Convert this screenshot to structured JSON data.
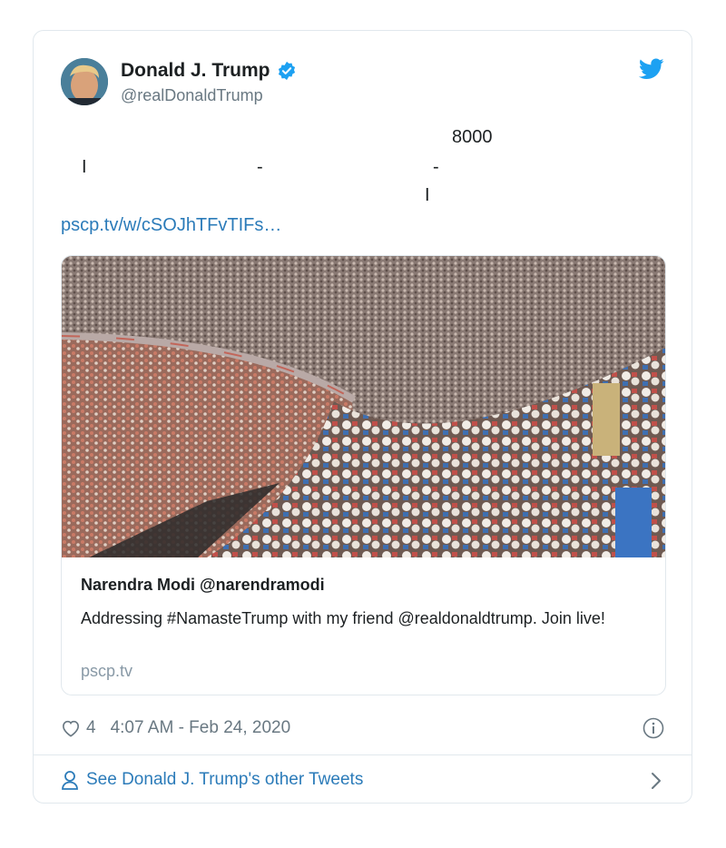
{
  "author": {
    "name": "Donald J. Trump",
    "handle": "@realDonaldTrump",
    "avatar_icon": "profile-photo",
    "verified_icon": "verified-badge-icon"
  },
  "tweet_text_fragments": [
    "8000",
    "I",
    "-",
    "-",
    "I"
  ],
  "link": "pscp.tv/w/cSOJhTFvTIFs…",
  "card": {
    "title": "Narendra Modi @narendramodi",
    "description": "Addressing #NamasteTrump with my friend @realdonaldtrump. Join live!",
    "domain": "pscp.tv"
  },
  "likes": "4",
  "timestamp": "4:07 AM - Feb 24, 2020",
  "footer_link": "See Donald J. Trump's other Tweets",
  "colors": {
    "link": "#2b7bb9",
    "twitter_blue": "#1da1f2",
    "muted": "#697882",
    "border": "#e1e8ed"
  }
}
